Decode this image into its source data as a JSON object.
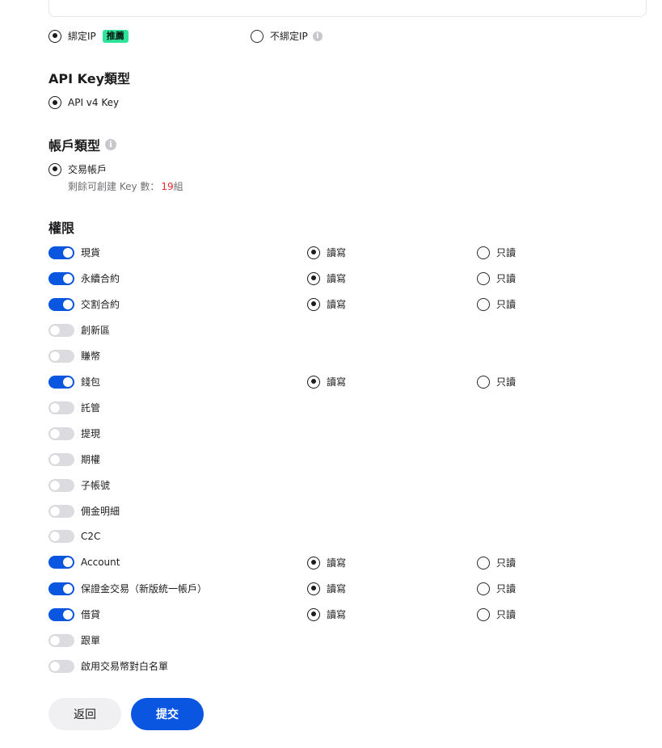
{
  "ip_binding": {
    "bind_label": "綁定IP",
    "bind_badge": "推薦",
    "bind_selected": true,
    "unbind_label": "不綁定IP",
    "unbind_selected": false,
    "info_glyph": "i"
  },
  "api_key_type": {
    "title": "API Key類型",
    "option": "API v4 Key",
    "selected": true
  },
  "account_type": {
    "title": "帳戶類型",
    "info_glyph": "i",
    "option": "交易帳戶",
    "selected": true,
    "remaining_prefix": "剩餘可創建 Key 數：",
    "remaining_count": "19",
    "remaining_suffix": "組"
  },
  "permissions": {
    "title": "權限",
    "read_write_label": "讀寫",
    "read_only_label": "只讀",
    "items": [
      {
        "label": "現貨",
        "enabled": true,
        "show_mode": true,
        "mode": "read_write"
      },
      {
        "label": "永續合約",
        "enabled": true,
        "show_mode": true,
        "mode": "read_write"
      },
      {
        "label": "交割合約",
        "enabled": true,
        "show_mode": true,
        "mode": "read_write"
      },
      {
        "label": "創新區",
        "enabled": false,
        "show_mode": false
      },
      {
        "label": "賺幣",
        "enabled": false,
        "show_mode": false
      },
      {
        "label": "錢包",
        "enabled": true,
        "show_mode": true,
        "mode": "read_write"
      },
      {
        "label": "託管",
        "enabled": false,
        "show_mode": false
      },
      {
        "label": "提現",
        "enabled": false,
        "show_mode": false
      },
      {
        "label": "期權",
        "enabled": false,
        "show_mode": false
      },
      {
        "label": "子帳號",
        "enabled": false,
        "show_mode": false
      },
      {
        "label": "佣金明細",
        "enabled": false,
        "show_mode": false
      },
      {
        "label": "C2C",
        "enabled": false,
        "show_mode": false
      },
      {
        "label": "Account",
        "enabled": true,
        "show_mode": true,
        "mode": "read_write"
      },
      {
        "label": "保證金交易（新版統一帳戶）",
        "enabled": true,
        "show_mode": true,
        "mode": "read_write"
      },
      {
        "label": "借貸",
        "enabled": true,
        "show_mode": true,
        "mode": "read_write"
      },
      {
        "label": "跟單",
        "enabled": false,
        "show_mode": false
      },
      {
        "label": "啟用交易幣對白名單",
        "enabled": false,
        "show_mode": false
      }
    ]
  },
  "buttons": {
    "back": "返回",
    "submit": "提交"
  },
  "colors": {
    "accent": "#0a56e0",
    "badge_green": "#2ee39a",
    "highlight_red": "#e0292e"
  }
}
